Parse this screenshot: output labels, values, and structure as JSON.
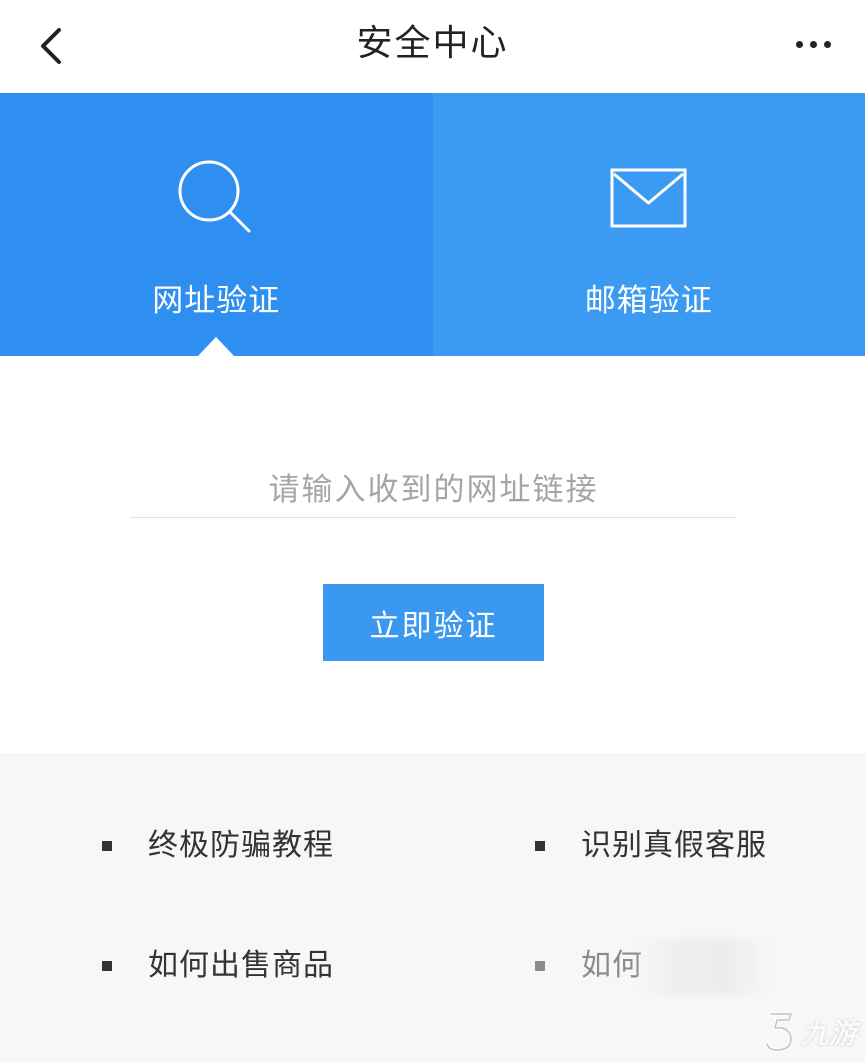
{
  "header": {
    "title": "安全中心"
  },
  "tabs": [
    {
      "label": "网址验证",
      "icon": "search-icon",
      "active": true
    },
    {
      "label": "邮箱验证",
      "icon": "mail-icon",
      "active": false
    }
  ],
  "form": {
    "placeholder": "请输入收到的网址链接",
    "button_label": "立即验证"
  },
  "links": [
    {
      "label": "终极防骗教程"
    },
    {
      "label": "识别真假客服"
    },
    {
      "label": "如何出售商品"
    },
    {
      "label": "如何"
    }
  ],
  "watermark": {
    "text": "九游"
  },
  "colors": {
    "primary": "#2f8ff0",
    "tab_inactive": "#3b9bf2",
    "button": "#3a98f0",
    "panel_bg": "#f7f7f7"
  }
}
